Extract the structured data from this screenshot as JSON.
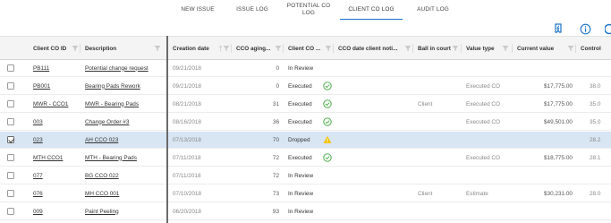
{
  "tabs": [
    {
      "label": "NEW ISSUE",
      "active": false
    },
    {
      "label": "ISSUE LOG",
      "active": false
    },
    {
      "label": "POTENTIAL CO LOG",
      "active": false
    },
    {
      "label": "CLIENT CO LOG",
      "active": true
    },
    {
      "label": "AUDIT LOG",
      "active": false
    }
  ],
  "toolbar": {
    "icons": [
      "flag-icon",
      "info-icon",
      "refresh-icon"
    ],
    "accent_color": "#1a73c8"
  },
  "table": {
    "columns": [
      {
        "label": "Client CO ID"
      },
      {
        "label": "Description"
      },
      {
        "label": "Creation date",
        "sorted": "ascending"
      },
      {
        "label": "CCO aging..."
      },
      {
        "label": "Client CO ..."
      },
      {
        "label": "CCO date client noti..."
      },
      {
        "label": "Ball in court"
      },
      {
        "label": "Value type"
      },
      {
        "label": "Current value"
      },
      {
        "label": "Control"
      }
    ],
    "rows": [
      {
        "checked": false,
        "id": "PB111",
        "description": "Potential change request",
        "creation_date": "09/21/2018",
        "aging": "0",
        "status": "In Review",
        "status_icon": "",
        "date_notified": "",
        "ball_in_court": "",
        "value_type": "",
        "current_value": "",
        "control": ""
      },
      {
        "checked": false,
        "id": "PB001",
        "description": "Bearing Pads Rework",
        "creation_date": "09/21/2018",
        "aging": "0",
        "status": "Executed",
        "status_icon": "check-circle-icon",
        "date_notified": "",
        "ball_in_court": "",
        "value_type": "Executed CO",
        "current_value": "$17,775.00",
        "control": "38.0"
      },
      {
        "checked": false,
        "id": "MWR - CCO1",
        "description": "MWR - Bearing Pads",
        "creation_date": "08/21/2018",
        "aging": "31",
        "status": "Executed",
        "status_icon": "check-circle-icon",
        "date_notified": "",
        "ball_in_court": "Client",
        "value_type": "Executed CO",
        "current_value": "$17,775.00",
        "control": "35.0"
      },
      {
        "checked": false,
        "id": "003",
        "description": "Change Order #3",
        "creation_date": "08/16/2018",
        "aging": "36",
        "status": "Executed",
        "status_icon": "check-circle-icon",
        "date_notified": "",
        "ball_in_court": "",
        "value_type": "Executed CO",
        "current_value": "$49,501.00",
        "control": "35.0"
      },
      {
        "checked": true,
        "id": "023",
        "description": "AH CCO 023",
        "creation_date": "07/13/2018",
        "aging": "70",
        "status": "Dropped",
        "status_icon": "warning-icon",
        "date_notified": "",
        "ball_in_court": "",
        "value_type": "",
        "current_value": "",
        "control": "28.2"
      },
      {
        "checked": false,
        "id": "MTH CCO1",
        "description": "MTH - Bearing Pads",
        "creation_date": "07/11/2018",
        "aging": "72",
        "status": "Executed",
        "status_icon": "check-circle-icon",
        "date_notified": "",
        "ball_in_court": "",
        "value_type": "Executed CO",
        "current_value": "$18,775.00",
        "control": "28.1"
      },
      {
        "checked": false,
        "id": "077",
        "description": "BG CCO 022",
        "creation_date": "07/11/2018",
        "aging": "72",
        "status": "In Review",
        "status_icon": "",
        "date_notified": "",
        "ball_in_court": "",
        "value_type": "",
        "current_value": "",
        "control": ""
      },
      {
        "checked": false,
        "id": "076",
        "description": "MH CCO 001",
        "creation_date": "07/10/2018",
        "aging": "73",
        "status": "In Review",
        "status_icon": "",
        "date_notified": "",
        "ball_in_court": "Client",
        "value_type": "Estimate",
        "current_value": "$30,231.00",
        "control": "28.0"
      },
      {
        "checked": false,
        "id": "009",
        "description": "Paint Peeling",
        "creation_date": "06/20/2018",
        "aging": "93",
        "status": "In Review",
        "status_icon": "",
        "date_notified": "",
        "ball_in_court": "",
        "value_type": "",
        "current_value": "",
        "control": ""
      }
    ],
    "colors": {
      "selected_row": "#d8e6f3",
      "check_green": "#3aa83a",
      "warning_yellow": "#f2c200"
    }
  }
}
